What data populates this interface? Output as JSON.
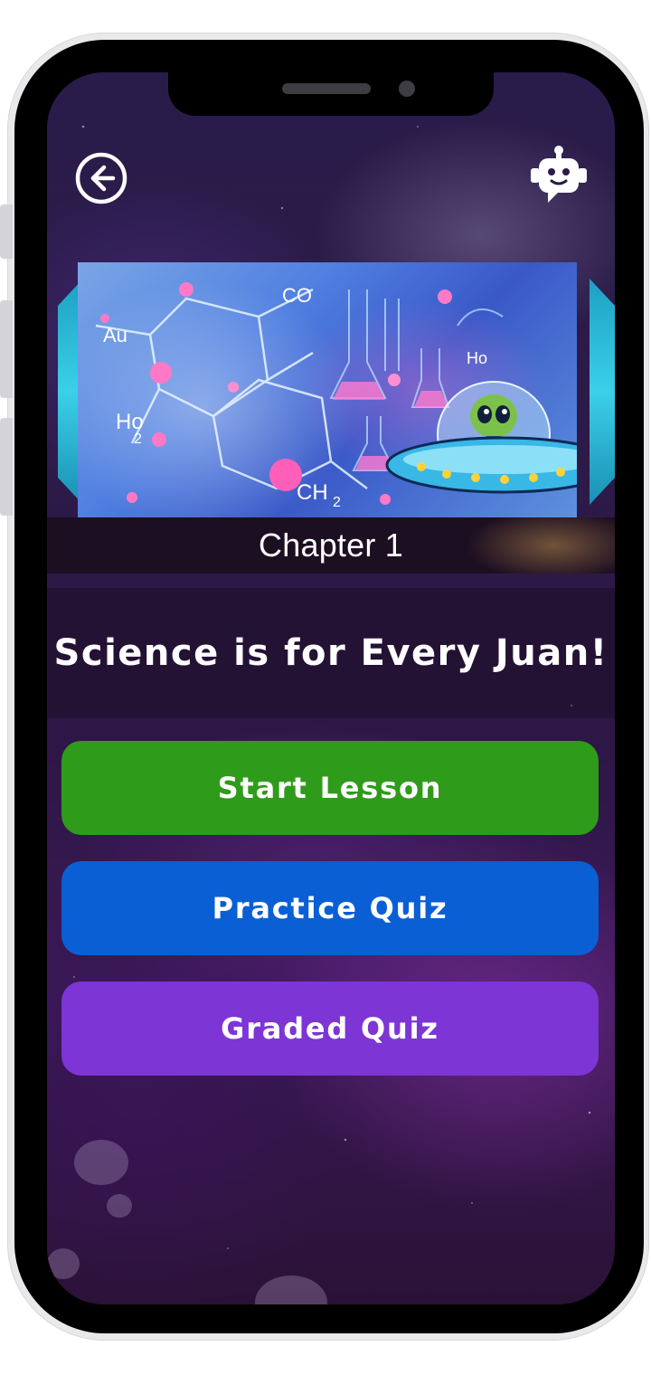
{
  "header": {
    "back_icon": "arrow-left-circle-icon",
    "assistant_icon": "robot-chat-icon"
  },
  "banner": {
    "chapter_label": "Chapter 1",
    "labels": {
      "au": "Au",
      "co": "CO",
      "ho": "Ho",
      "ho2": "2",
      "ch": "CH",
      "ch2": "2",
      "ho_small": "Ho"
    }
  },
  "lesson": {
    "title": "Science is for Every Juan!"
  },
  "actions": {
    "start_label": "Start Lesson",
    "practice_label": "Practice Quiz",
    "graded_label": "Graded Quiz"
  },
  "colors": {
    "start": "#2f9b1a",
    "practice": "#0a5fd4",
    "graded": "#7d35d6"
  }
}
